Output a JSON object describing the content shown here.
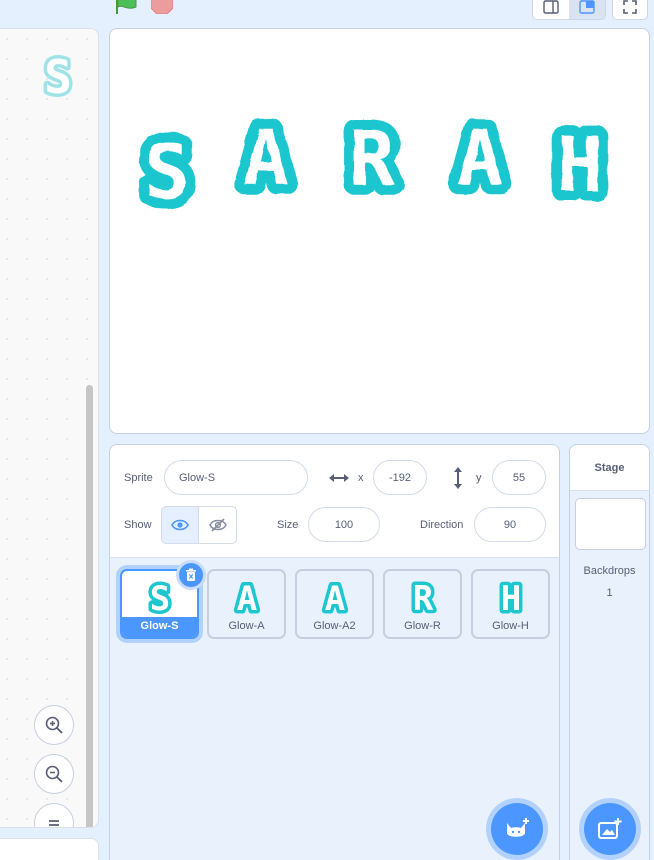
{
  "controls": {
    "green_flag": "green-flag-icon",
    "stop": "stop-sign-icon"
  },
  "stage_letters": [
    "S",
    "A",
    "R",
    "A",
    "H"
  ],
  "colors": {
    "glow": "#1ec6cf",
    "accent": "#4c97ff",
    "text": "#575e75"
  },
  "sprite_info": {
    "sprite_label": "Sprite",
    "sprite_name": "Glow-S",
    "x_label": "x",
    "x_value": "-192",
    "y_label": "y",
    "y_value": "55",
    "show_label": "Show",
    "size_label": "Size",
    "size_value": "100",
    "direction_label": "Direction",
    "direction_value": "90"
  },
  "sprites": [
    {
      "name": "Glow-S",
      "letter": "S",
      "selected": true
    },
    {
      "name": "Glow-A",
      "letter": "A",
      "selected": false
    },
    {
      "name": "Glow-A2",
      "letter": "A",
      "selected": false
    },
    {
      "name": "Glow-R",
      "letter": "R",
      "selected": false
    },
    {
      "name": "Glow-H",
      "letter": "H",
      "selected": false
    }
  ],
  "stage_panel": {
    "title": "Stage",
    "backdrops_label": "Backdrops",
    "backdrops_count": "1"
  }
}
